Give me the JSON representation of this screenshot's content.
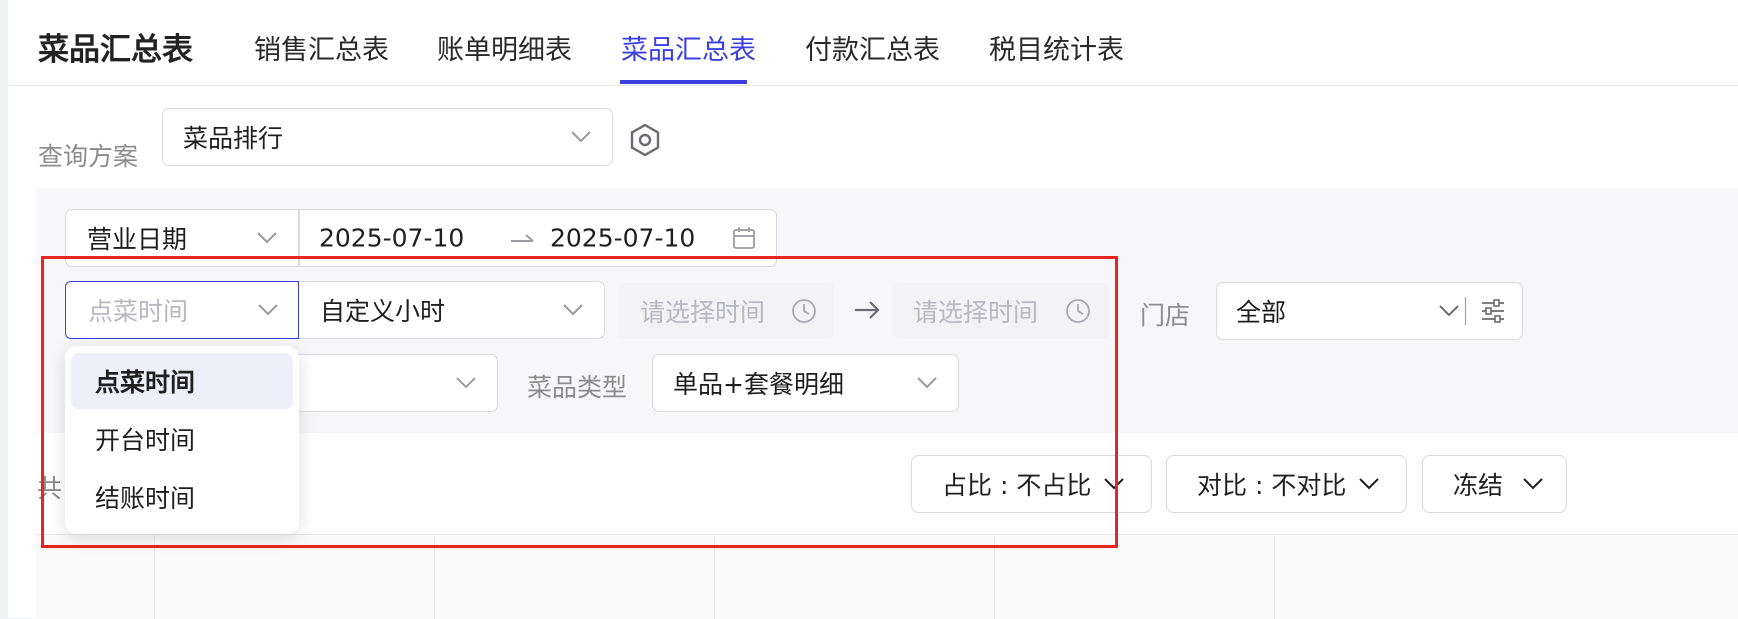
{
  "header": {
    "title": "菜品汇总表",
    "tabs": [
      {
        "label": "销售汇总表",
        "active": false
      },
      {
        "label": "账单明细表",
        "active": false
      },
      {
        "label": "菜品汇总表",
        "active": true
      },
      {
        "label": "付款汇总表",
        "active": false
      },
      {
        "label": "税目统计表",
        "active": false
      }
    ]
  },
  "query": {
    "label": "查询方案",
    "scheme_value": "菜品排行",
    "settings_icon": "hexagon-settings-icon"
  },
  "filters": {
    "date_type": "营业日期",
    "date_start": "2025-07-10",
    "date_end": "2025-07-10",
    "time_type_placeholder": "点菜时间",
    "time_range_mode": "自定义小时",
    "time_start_placeholder": "请选择时间",
    "time_end_placeholder": "请选择时间",
    "store_label": "门店",
    "store_value": "全部",
    "row3_select_value": "",
    "dish_type_label": "菜品类型",
    "dish_type_value": "单品+套餐明细"
  },
  "toolbar": {
    "total_prefix": "共",
    "ratio_button": "占比 : 不占比",
    "compare_button": "对比 : 不对比",
    "freeze_button": "冻结"
  },
  "dropdown": {
    "options": [
      {
        "label": "点菜时间",
        "selected": true
      },
      {
        "label": "开台时间",
        "selected": false
      },
      {
        "label": "结账时间",
        "selected": false
      }
    ]
  },
  "colors": {
    "accent": "#3b3fe0",
    "highlight_border": "#e8251f",
    "selected_bg": "#efeffb"
  }
}
